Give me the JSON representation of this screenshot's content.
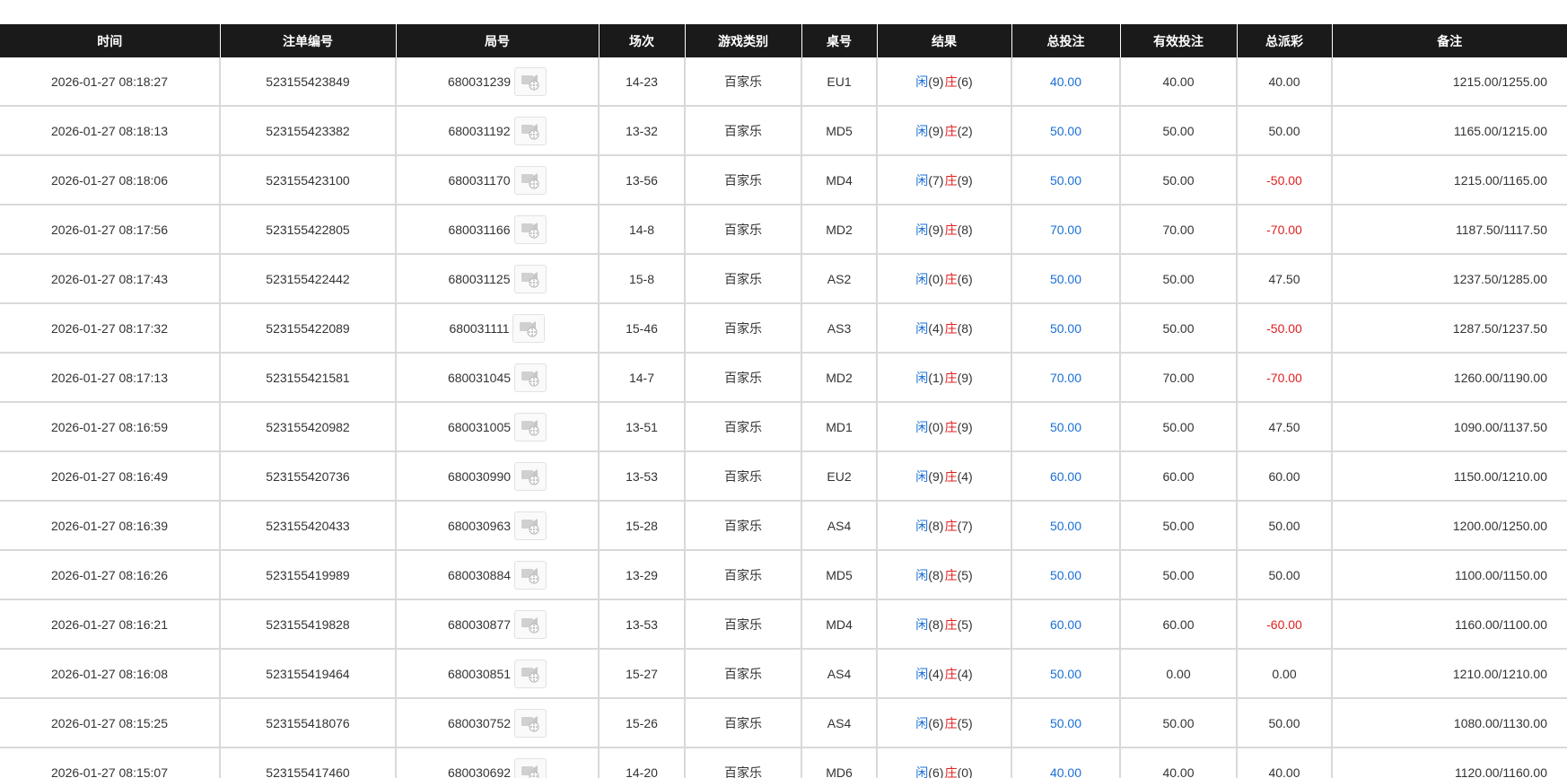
{
  "colors": {
    "header_bg": "#1a1a1a",
    "player": "#1a6fd6",
    "banker": "#e02020",
    "total_bet": "#1a6fd6",
    "negative": "#e02020"
  },
  "headers": [
    "时间",
    "注单编号",
    "局号",
    "场次",
    "游戏类别",
    "桌号",
    "结果",
    "总投注",
    "有效投注",
    "总派彩",
    "备注"
  ],
  "result_labels": {
    "player": "闲",
    "banker": "庄"
  },
  "rows": [
    {
      "time": "2026-01-27 08:18:27",
      "order": "523155423849",
      "round": "680031239",
      "session": "14-23",
      "game": "百家乐",
      "table": "EU1",
      "player": "(9)",
      "banker": "(6)",
      "total_bet": "40.00",
      "valid_bet": "40.00",
      "payout": "40.00",
      "payout_negative": false,
      "note": "1215.00/1255.00"
    },
    {
      "time": "2026-01-27 08:18:13",
      "order": "523155423382",
      "round": "680031192",
      "session": "13-32",
      "game": "百家乐",
      "table": "MD5",
      "player": "(9)",
      "banker": "(2)",
      "total_bet": "50.00",
      "valid_bet": "50.00",
      "payout": "50.00",
      "payout_negative": false,
      "note": "1165.00/1215.00"
    },
    {
      "time": "2026-01-27 08:18:06",
      "order": "523155423100",
      "round": "680031170",
      "session": "13-56",
      "game": "百家乐",
      "table": "MD4",
      "player": "(7)",
      "banker": "(9)",
      "total_bet": "50.00",
      "valid_bet": "50.00",
      "payout": "-50.00",
      "payout_negative": true,
      "note": "1215.00/1165.00"
    },
    {
      "time": "2026-01-27 08:17:56",
      "order": "523155422805",
      "round": "680031166",
      "session": "14-8",
      "game": "百家乐",
      "table": "MD2",
      "player": "(9)",
      "banker": "(8)",
      "total_bet": "70.00",
      "valid_bet": "70.00",
      "payout": "-70.00",
      "payout_negative": true,
      "note": "1187.50/1117.50"
    },
    {
      "time": "2026-01-27 08:17:43",
      "order": "523155422442",
      "round": "680031125",
      "session": "15-8",
      "game": "百家乐",
      "table": "AS2",
      "player": "(0)",
      "banker": "(6)",
      "total_bet": "50.00",
      "valid_bet": "50.00",
      "payout": "47.50",
      "payout_negative": false,
      "note": "1237.50/1285.00"
    },
    {
      "time": "2026-01-27 08:17:32",
      "order": "523155422089",
      "round": "680031111",
      "session": "15-46",
      "game": "百家乐",
      "table": "AS3",
      "player": "(4)",
      "banker": "(8)",
      "total_bet": "50.00",
      "valid_bet": "50.00",
      "payout": "-50.00",
      "payout_negative": true,
      "note": "1287.50/1237.50"
    },
    {
      "time": "2026-01-27 08:17:13",
      "order": "523155421581",
      "round": "680031045",
      "session": "14-7",
      "game": "百家乐",
      "table": "MD2",
      "player": "(1)",
      "banker": "(9)",
      "total_bet": "70.00",
      "valid_bet": "70.00",
      "payout": "-70.00",
      "payout_negative": true,
      "note": "1260.00/1190.00"
    },
    {
      "time": "2026-01-27 08:16:59",
      "order": "523155420982",
      "round": "680031005",
      "session": "13-51",
      "game": "百家乐",
      "table": "MD1",
      "player": "(0)",
      "banker": "(9)",
      "total_bet": "50.00",
      "valid_bet": "50.00",
      "payout": "47.50",
      "payout_negative": false,
      "note": "1090.00/1137.50"
    },
    {
      "time": "2026-01-27 08:16:49",
      "order": "523155420736",
      "round": "680030990",
      "session": "13-53",
      "game": "百家乐",
      "table": "EU2",
      "player": "(9)",
      "banker": "(4)",
      "total_bet": "60.00",
      "valid_bet": "60.00",
      "payout": "60.00",
      "payout_negative": false,
      "note": "1150.00/1210.00"
    },
    {
      "time": "2026-01-27 08:16:39",
      "order": "523155420433",
      "round": "680030963",
      "session": "15-28",
      "game": "百家乐",
      "table": "AS4",
      "player": "(8)",
      "banker": "(7)",
      "total_bet": "50.00",
      "valid_bet": "50.00",
      "payout": "50.00",
      "payout_negative": false,
      "note": "1200.00/1250.00"
    },
    {
      "time": "2026-01-27 08:16:26",
      "order": "523155419989",
      "round": "680030884",
      "session": "13-29",
      "game": "百家乐",
      "table": "MD5",
      "player": "(8)",
      "banker": "(5)",
      "total_bet": "50.00",
      "valid_bet": "50.00",
      "payout": "50.00",
      "payout_negative": false,
      "note": "1100.00/1150.00"
    },
    {
      "time": "2026-01-27 08:16:21",
      "order": "523155419828",
      "round": "680030877",
      "session": "13-53",
      "game": "百家乐",
      "table": "MD4",
      "player": "(8)",
      "banker": "(5)",
      "total_bet": "60.00",
      "valid_bet": "60.00",
      "payout": "-60.00",
      "payout_negative": true,
      "note": "1160.00/1100.00"
    },
    {
      "time": "2026-01-27 08:16:08",
      "order": "523155419464",
      "round": "680030851",
      "session": "15-27",
      "game": "百家乐",
      "table": "AS4",
      "player": "(4)",
      "banker": "(4)",
      "total_bet": "50.00",
      "valid_bet": "0.00",
      "payout": "0.00",
      "payout_negative": false,
      "note": "1210.00/1210.00"
    },
    {
      "time": "2026-01-27 08:15:25",
      "order": "523155418076",
      "round": "680030752",
      "session": "15-26",
      "game": "百家乐",
      "table": "AS4",
      "player": "(6)",
      "banker": "(5)",
      "total_bet": "50.00",
      "valid_bet": "50.00",
      "payout": "50.00",
      "payout_negative": false,
      "note": "1080.00/1130.00"
    },
    {
      "time": "2026-01-27 08:15:07",
      "order": "523155417460",
      "round": "680030692",
      "session": "14-20",
      "game": "百家乐",
      "table": "MD6",
      "player": "(6)",
      "banker": "(0)",
      "total_bet": "40.00",
      "valid_bet": "40.00",
      "payout": "40.00",
      "payout_negative": false,
      "note": "1120.00/1160.00"
    }
  ]
}
